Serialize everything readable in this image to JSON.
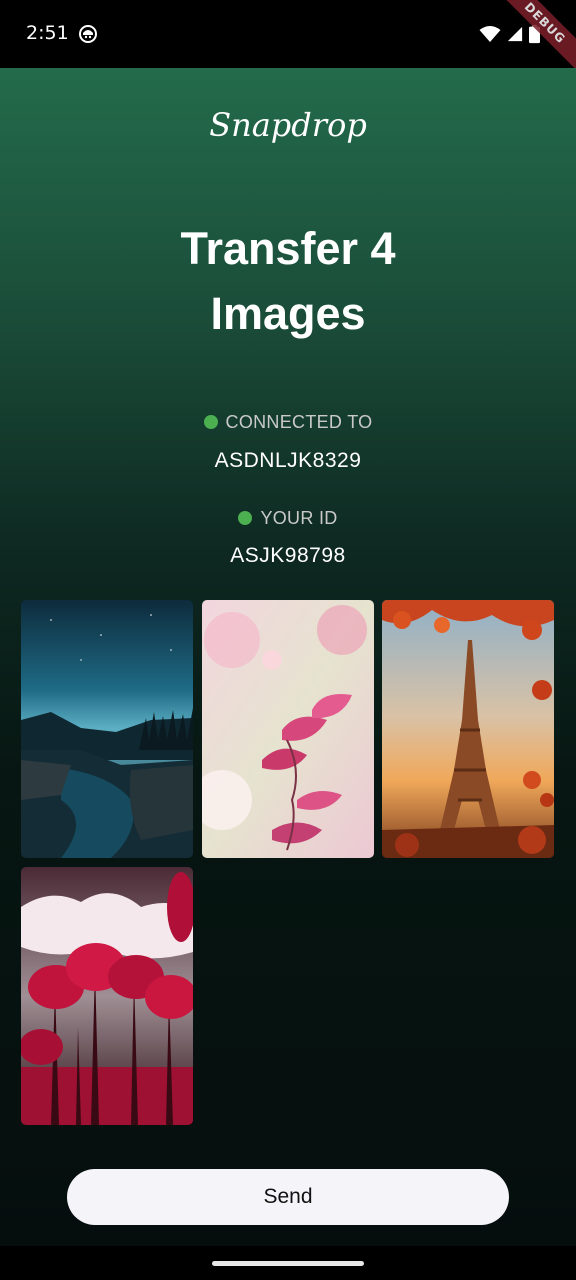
{
  "status_bar": {
    "time": "2:51",
    "icons": [
      "app-notification-icon",
      "wifi-icon",
      "signal-icon",
      "battery-icon"
    ],
    "debug_label": "DEBUG"
  },
  "app": {
    "brand": "Snapdrop",
    "title_line1": "Transfer 4",
    "title_line2": "Images"
  },
  "connection": {
    "connected_label": "CONNECTED TO",
    "connected_value": "ASDNLJK8329",
    "your_id_label": "YOUR ID",
    "your_id_value": "ASJK98798",
    "status_color": "#4caf50"
  },
  "images": [
    {
      "name": "night-lake-landscape"
    },
    {
      "name": "pink-leaves"
    },
    {
      "name": "eiffel-tower-autumn"
    },
    {
      "name": "red-forest"
    }
  ],
  "actions": {
    "send_label": "Send"
  }
}
